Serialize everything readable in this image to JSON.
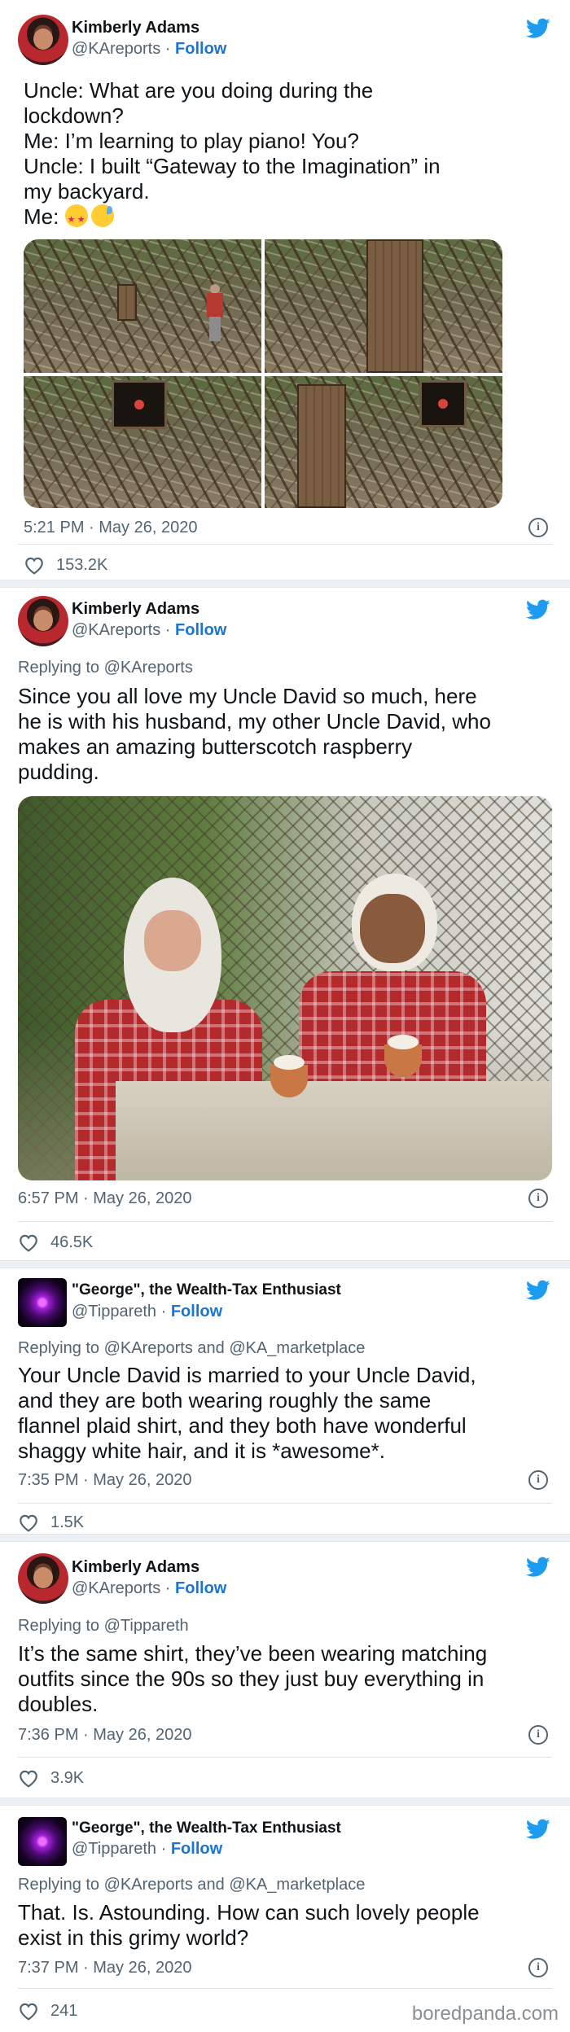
{
  "tweets": [
    {
      "author": {
        "name": "Kimberly Adams",
        "handle": "@KAreports",
        "follow": "Follow",
        "avatar": "avatar-photo"
      },
      "lines": [
        "Uncle: What are you doing during the",
        "lockdown?",
        "Me: I’m learning to play piano! You?",
        "Uncle: I built “Gateway to the Imagination” in",
        "my backyard.",
        "Me:"
      ],
      "emojis": [
        "star-struck-emoji",
        "grinning-sweat-emoji"
      ],
      "timestamp": "5:21 PM · May 26, 2020",
      "likes": "153.2K"
    },
    {
      "author": {
        "name": "Kimberly Adams",
        "handle": "@KAreports",
        "follow": "Follow"
      },
      "replying": "Replying to @KAreports",
      "lines": [
        "Since you all love my Uncle David so much, here",
        "he is with his husband, my other Uncle David, who",
        "makes an amazing butterscotch raspberry",
        "pudding."
      ],
      "timestamp": "6:57 PM · May 26, 2020",
      "likes": "46.5K"
    },
    {
      "author": {
        "name": "\"George\", the Wealth-Tax Enthusiast",
        "handle": "@Tippareth",
        "follow": "Follow"
      },
      "replying": "Replying to @KAreports and @KA_marketplace",
      "lines": [
        "Your Uncle David is married to your Uncle David,",
        "and they are both wearing roughly the same",
        "flannel plaid shirt, and they both have wonderful",
        "shaggy white hair, and it is *awesome*."
      ],
      "timestamp": "7:35 PM · May 26, 2020",
      "likes": "1.5K"
    },
    {
      "author": {
        "name": "Kimberly Adams",
        "handle": "@KAreports",
        "follow": "Follow"
      },
      "replying": "Replying to @Tippareth",
      "lines": [
        "It’s the same shirt, they’ve been wearing matching",
        "outfits since the 90s so they just buy everything in",
        "doubles."
      ],
      "timestamp": "7:36 PM · May 26, 2020",
      "likes": "3.9K"
    },
    {
      "author": {
        "name": "\"George\", the Wealth-Tax Enthusiast",
        "handle": "@Tippareth",
        "follow": "Follow"
      },
      "replying": "Replying to @KAreports and @KA_marketplace",
      "lines": [
        "That.  Is.  Astounding.  How can such lovely people",
        "exist in this grimy world?"
      ],
      "timestamp": "7:37 PM · May 26, 2020",
      "likes": "241"
    }
  ],
  "watermark": "boredpanda.com",
  "colors": {
    "twitter_blue": "#1d9bf0",
    "follow_link": "#1b75d0",
    "secondary_text": "#536471"
  }
}
